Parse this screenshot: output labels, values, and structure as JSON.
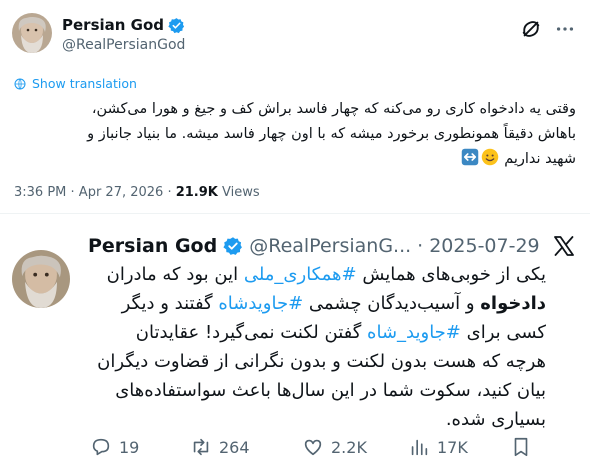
{
  "post": {
    "display_name": "Persian God",
    "handle": "@RealPersianGod",
    "show_translation": "Show translation",
    "text_line1": "وقتی یه دادخواه کاری رو می‌کنه که چهار فاسد براش کف و جیغ و هورا می‌کشن،",
    "text_line2": "باهاش دقیقاً همونطوری برخورد میشه که با اون چهار فاسد میشه. ما بنیاد جانباز و",
    "text_line3": "شهید نداریم",
    "time": "3:36 PM",
    "date": "Apr 27, 2026",
    "views_count": "21.9K",
    "views_label": "Views"
  },
  "quoted": {
    "display_name": "Persian God",
    "handle": "@RealPersianG...",
    "dot": "·",
    "date": "2025-07-29",
    "seg1": "یکی از خوبی‌های همایش ",
    "tag1": "#همکاری_ملی",
    "seg2": " این بود که مادران",
    "bold1": "دادخواه",
    "seg3": " و آسیب‌دیدگان چشمی ",
    "tag2": "#جاویدشاه",
    "seg4": " گفتند و دیگر",
    "seg5": "کسی برای ",
    "tag3": "#جاوید_شاه",
    "seg6": " گفتن لکنت نمی‌گیرد! عقایدتان",
    "line5": "هرچه که هست بدون لکنت و بدون نگرانی از قضاوت دیگران",
    "line6": "بیان کنید، سکوت شما در این سال‌ها باعث سواستفاده‌های",
    "line7": "بسیاری شده."
  },
  "actions": {
    "replies": "19",
    "reposts": "264",
    "likes": "2.2K",
    "views": "17K"
  },
  "colors": {
    "accent": "#1d9bf0",
    "muted": "#536471",
    "text": "#0f1419",
    "divider": "#eff3f4"
  },
  "icons": [
    "verified-badge-icon",
    "grok-icon",
    "more-icon",
    "globe-icon",
    "smile-emoji-icon",
    "left-right-arrow-emoji-icon",
    "x-logo-icon",
    "reply-icon",
    "repost-icon",
    "like-icon",
    "views-icon",
    "bookmark-icon"
  ]
}
